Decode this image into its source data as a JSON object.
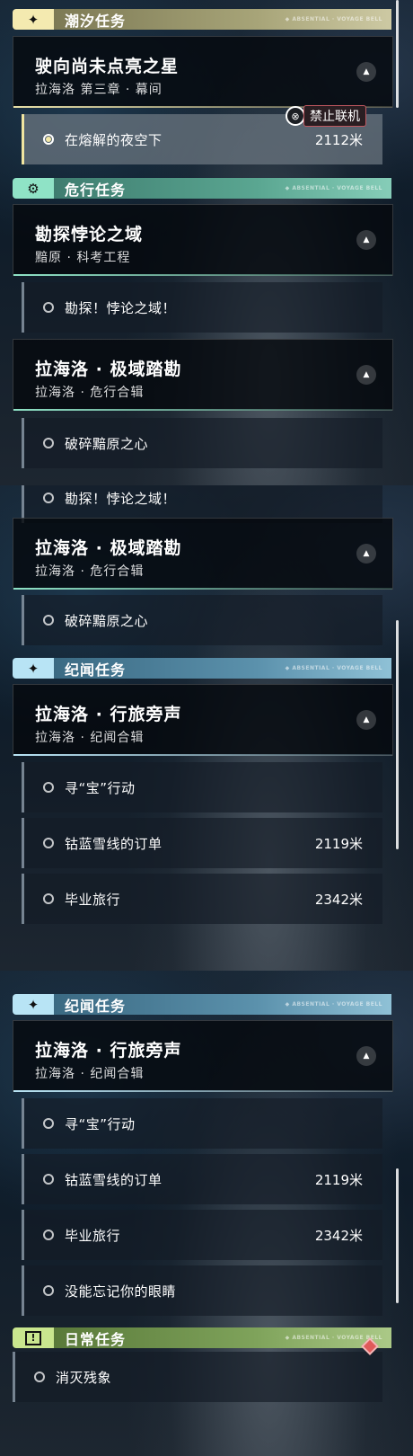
{
  "panel1": {
    "tide_header": {
      "title": "潮汐任务",
      "tag": "◆ ABSENTIAL · VOYAGE BELL"
    },
    "main_card": {
      "title": "驶向尚未点亮之星",
      "subtitle": "拉海洛 第三章 · 幕间"
    },
    "active_task": {
      "label": "在熔解的夜空下",
      "distance": "2112米"
    },
    "lock_badge": {
      "label": "禁止联机"
    },
    "danger_header": {
      "title": "危行任务",
      "tag": "◆ ABSENTIAL · VOYAGE BELL"
    },
    "card_a": {
      "title": "勘探悖论之域",
      "subtitle": "黯原 · 科考工程"
    },
    "row_a": {
      "label": "勘探！悖论之域！"
    },
    "card_b": {
      "title": "拉海洛 · 极域踏勘",
      "subtitle": "拉海洛 · 危行合辑"
    },
    "row_b": {
      "label": "破碎黯原之心"
    }
  },
  "panel2": {
    "row_top": {
      "label": "勘探！悖论之域！"
    },
    "card_b": {
      "title": "拉海洛 · 极域踏勘",
      "subtitle": "拉海洛 · 危行合辑"
    },
    "row_b": {
      "label": "破碎黯原之心"
    },
    "story_header": {
      "title": "纪闻任务",
      "tag": "◆ ABSENTIAL · VOYAGE BELL"
    },
    "card_c": {
      "title": "拉海洛 · 行旅旁声",
      "subtitle": "拉海洛 · 纪闻合辑"
    },
    "rows": [
      {
        "label": "寻“宝”行动",
        "distance": ""
      },
      {
        "label": "钴蓝雪线的订单",
        "distance": "2119米"
      },
      {
        "label": "毕业旅行",
        "distance": "2342米"
      }
    ]
  },
  "panel3": {
    "story_header": {
      "title": "纪闻任务",
      "tag": "◆ ABSENTIAL · VOYAGE BELL"
    },
    "card_c": {
      "title": "拉海洛 · 行旅旁声",
      "subtitle": "拉海洛 · 纪闻合辑"
    },
    "rows": [
      {
        "label": "寻“宝”行动",
        "distance": ""
      },
      {
        "label": "钴蓝雪线的订单",
        "distance": "2119米"
      },
      {
        "label": "毕业旅行",
        "distance": "2342米"
      },
      {
        "label": "没能忘记你的眼睛",
        "distance": ""
      }
    ],
    "daily_header": {
      "title": "日常任务",
      "tag": "◆ ABSENTIAL · VOYAGE BELL"
    },
    "daily_row": {
      "label": "消灭残象"
    }
  },
  "icons": {
    "tide": "star-icon",
    "danger": "gear-icon",
    "story": "star-icon",
    "daily": "exclamation-icon",
    "expand": "chevron-up-icon",
    "lock": "network-lock-icon"
  },
  "colors": {
    "tide": "#f4eab0",
    "danger": "#8fe3c6",
    "story": "#b8e4f5",
    "daily": "#c9e68e",
    "lock_border": "#c05860",
    "marker": "#e05a5a"
  }
}
